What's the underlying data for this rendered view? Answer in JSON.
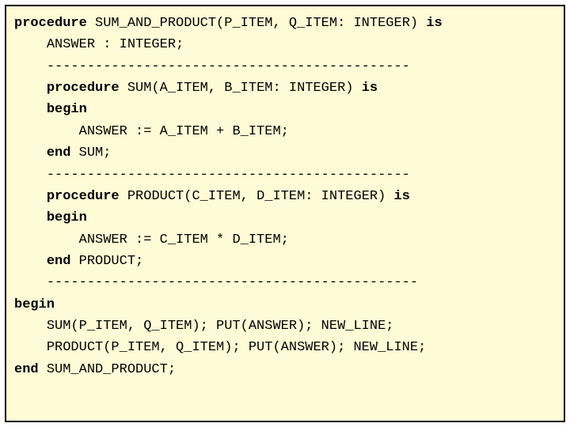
{
  "code": {
    "lines": [
      {
        "indent": 0,
        "segments": [
          {
            "text": "procedure ",
            "bold": true
          },
          {
            "text": "SUM_AND_PRODUCT(P_ITEM, Q_ITEM: INTEGER) ",
            "bold": false
          },
          {
            "text": "is",
            "bold": true
          }
        ]
      },
      {
        "indent": 1,
        "segments": [
          {
            "text": "ANSWER : INTEGER;",
            "bold": false
          }
        ]
      },
      {
        "indent": 1,
        "segments": [
          {
            "text": "---------------------------------------------",
            "bold": false
          }
        ]
      },
      {
        "indent": 1,
        "segments": [
          {
            "text": "procedure ",
            "bold": true
          },
          {
            "text": "SUM(A_ITEM, B_ITEM: INTEGER) ",
            "bold": false
          },
          {
            "text": "is",
            "bold": true
          }
        ]
      },
      {
        "indent": 1,
        "segments": [
          {
            "text": "begin",
            "bold": true
          }
        ]
      },
      {
        "indent": 2,
        "segments": [
          {
            "text": "ANSWER := A_ITEM + B_ITEM;",
            "bold": false
          }
        ]
      },
      {
        "indent": 1,
        "segments": [
          {
            "text": "end ",
            "bold": true
          },
          {
            "text": "SUM;",
            "bold": false
          }
        ]
      },
      {
        "indent": 1,
        "segments": [
          {
            "text": "---------------------------------------------",
            "bold": false
          }
        ]
      },
      {
        "indent": 1,
        "segments": [
          {
            "text": "procedure ",
            "bold": true
          },
          {
            "text": "PRODUCT(C_ITEM, D_ITEM: INTEGER) ",
            "bold": false
          },
          {
            "text": "is",
            "bold": true
          }
        ]
      },
      {
        "indent": 1,
        "segments": [
          {
            "text": "begin",
            "bold": true
          }
        ]
      },
      {
        "indent": 2,
        "segments": [
          {
            "text": "ANSWER := C_ITEM * D_ITEM;",
            "bold": false
          }
        ]
      },
      {
        "indent": 1,
        "segments": [
          {
            "text": "end ",
            "bold": true
          },
          {
            "text": "PRODUCT;",
            "bold": false
          }
        ]
      },
      {
        "indent": 1,
        "segments": [
          {
            "text": "----------------------------------------------",
            "bold": false
          }
        ]
      },
      {
        "indent": 0,
        "segments": [
          {
            "text": "begin",
            "bold": true
          }
        ]
      },
      {
        "indent": 1,
        "segments": [
          {
            "text": "SUM(P_ITEM, Q_ITEM); PUT(ANSWER); NEW_LINE;",
            "bold": false
          }
        ]
      },
      {
        "indent": 1,
        "segments": [
          {
            "text": "PRODUCT(P_ITEM, Q_ITEM); PUT(ANSWER); NEW_LINE;",
            "bold": false
          }
        ]
      },
      {
        "indent": 0,
        "segments": [
          {
            "text": "end ",
            "bold": true
          },
          {
            "text": "SUM_AND_PRODUCT;",
            "bold": false
          }
        ]
      }
    ],
    "indent_unit": "    "
  }
}
